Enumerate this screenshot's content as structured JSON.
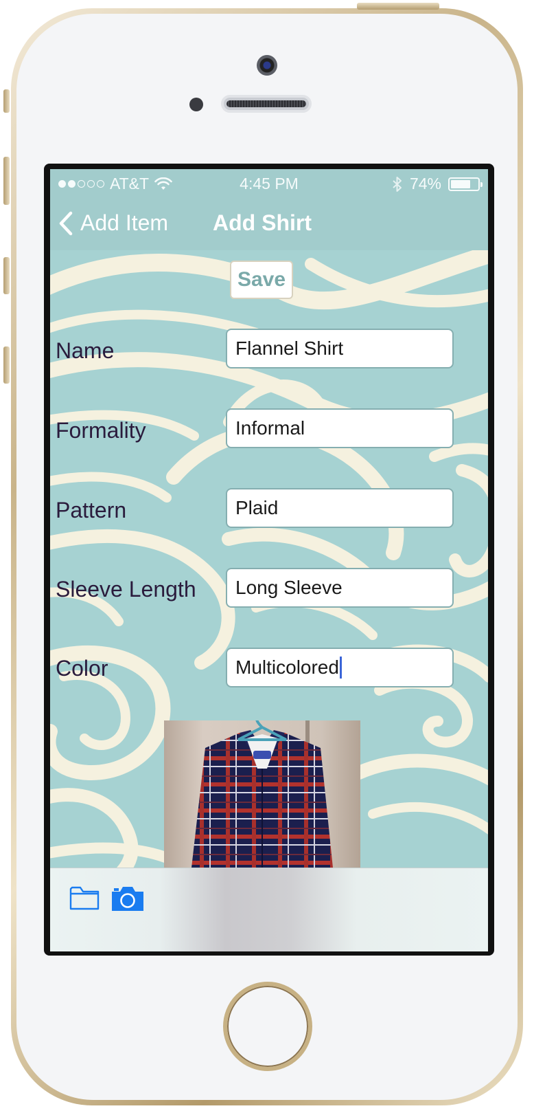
{
  "status_bar": {
    "carrier": "AT&T",
    "time": "4:45 PM",
    "battery_percent": "74%",
    "battery_level": 0.74,
    "signal_bars_filled": 2,
    "signal_bars_total": 5
  },
  "nav": {
    "back_label": "Add Item",
    "title": "Add Shirt"
  },
  "form": {
    "save_label": "Save",
    "fields": [
      {
        "label": "Name",
        "value": "Flannel Shirt"
      },
      {
        "label": "Formality",
        "value": "Informal"
      },
      {
        "label": "Pattern",
        "value": "Plaid"
      },
      {
        "label": "Sleeve Length",
        "value": "Long Sleeve"
      },
      {
        "label": "Color",
        "value": "Multicolored"
      }
    ]
  },
  "toolbar": {
    "icons": [
      "folder-icon",
      "camera-icon"
    ],
    "accent": "#1a7cf0"
  },
  "colors": {
    "nav_background": "#a2cccc",
    "label_text": "#2a1b3c",
    "save_text": "#7aa9a9"
  }
}
